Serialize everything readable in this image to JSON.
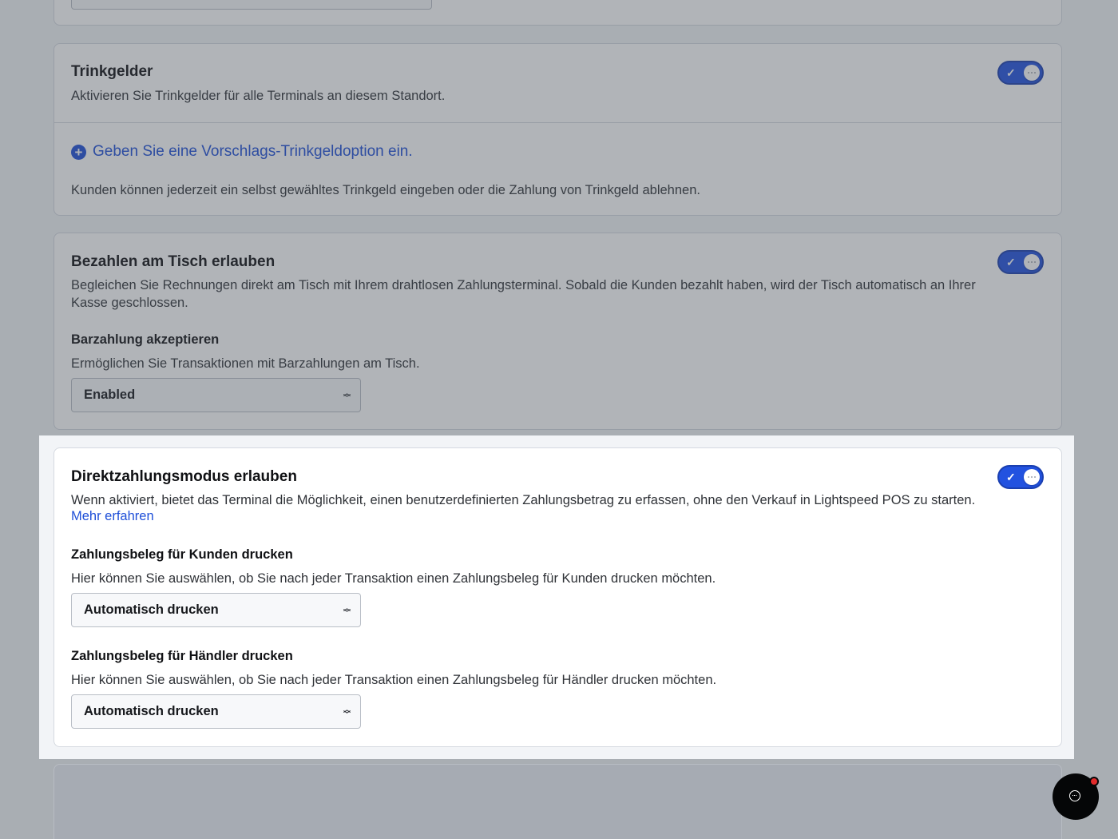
{
  "tips": {
    "title": "Trinkgelder",
    "description": "Aktivieren Sie Trinkgelder für alle Terminals an diesem Standort.",
    "toggle_on": true,
    "add_option_label": "Geben Sie eine Vorschlags-Trinkgeldoption ein.",
    "note": "Kunden können jederzeit ein selbst gewähltes Trinkgeld eingeben oder die Zahlung von Trinkgeld ablehnen."
  },
  "pay_at_table": {
    "title": "Bezahlen am Tisch erlauben",
    "description": "Begleichen Sie Rechnungen direkt am Tisch mit Ihrem drahtlosen Zahlungsterminal. Sobald die Kunden bezahlt haben, wird der Tisch automatisch an Ihrer Kasse geschlossen.",
    "toggle_on": true,
    "cash": {
      "title": "Barzahlung akzeptieren",
      "description": "Ermöglichen Sie Transaktionen mit Barzahlungen am Tisch.",
      "selected": "Enabled"
    }
  },
  "direct_payment": {
    "title": "Direktzahlungsmodus erlauben",
    "description": "Wenn aktiviert, bietet das Terminal die Möglichkeit, einen benutzerdefinierten Zahlungsbetrag zu erfassen, ohne den Verkauf in Lightspeed POS zu starten.",
    "more_link": "Mehr erfahren",
    "toggle_on": true,
    "customer_receipt": {
      "title": "Zahlungsbeleg für Kunden drucken",
      "description": "Hier können Sie auswählen, ob Sie nach jeder Transaktion einen Zahlungsbeleg für Kunden drucken möchten.",
      "selected": "Automatisch drucken"
    },
    "merchant_receipt": {
      "title": "Zahlungsbeleg für Händler drucken",
      "description": "Hier können Sie auswählen, ob Sie nach jeder Transaktion einen Zahlungsbeleg für Händler drucken möchten.",
      "selected": "Automatisch drucken"
    }
  },
  "chat": {
    "icon": "chat-bubble-icon",
    "has_notification": true
  },
  "colors": {
    "accent": "#1e4fd8",
    "toggle": "#2252e0",
    "notification": "#e22b2b"
  }
}
